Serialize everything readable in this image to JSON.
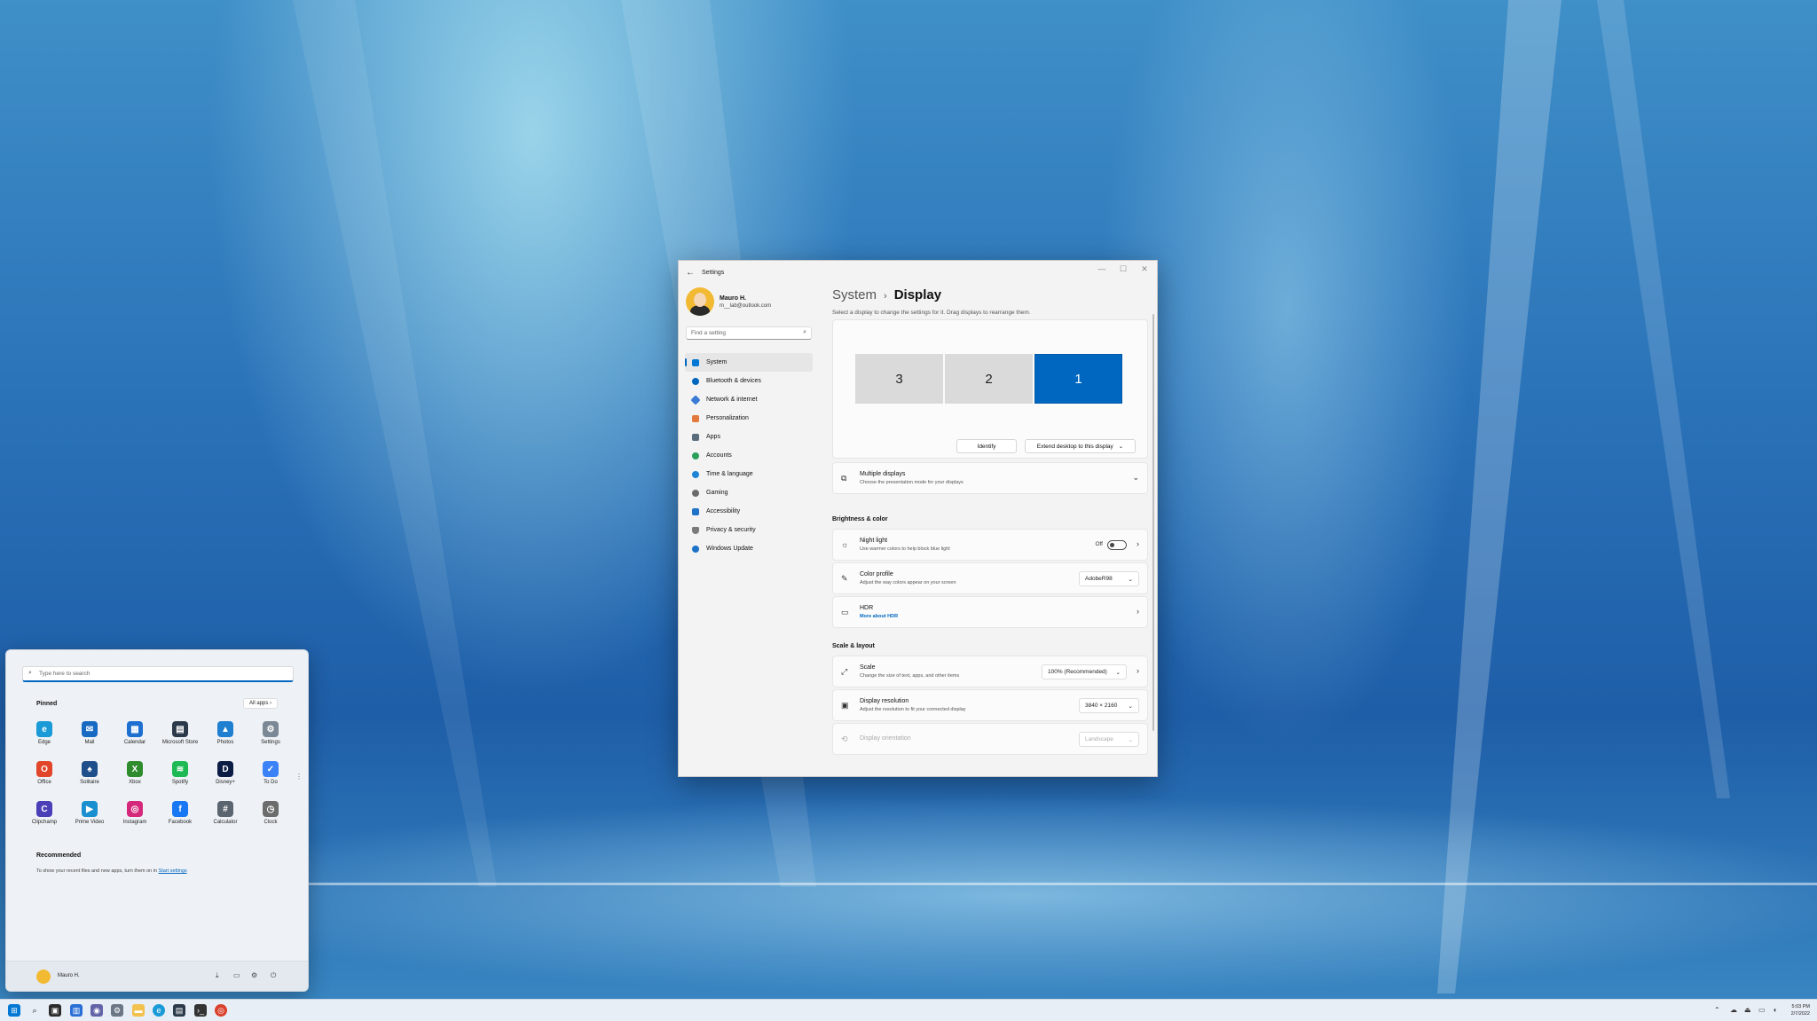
{
  "settings": {
    "window_title": "Settings",
    "user": {
      "name": "Mauro H.",
      "email": "m__lab@outlook.com"
    },
    "search_placeholder": "Find a setting",
    "nav": [
      {
        "label": "System",
        "icon": "monitor-icon",
        "color": "#0078d4"
      },
      {
        "label": "Bluetooth & devices",
        "icon": "bluetooth-icon",
        "color": "#0067c0"
      },
      {
        "label": "Network & internet",
        "icon": "wifi-icon",
        "color": "#3a7bd5"
      },
      {
        "label": "Personalization",
        "icon": "brush-icon",
        "color": "#e3793c"
      },
      {
        "label": "Apps",
        "icon": "apps-icon",
        "color": "#5a6b7b"
      },
      {
        "label": "Accounts",
        "icon": "person-icon",
        "color": "#2aa05a"
      },
      {
        "label": "Time & language",
        "icon": "globe-clock-icon",
        "color": "#1f83d6"
      },
      {
        "label": "Gaming",
        "icon": "gamepad-icon",
        "color": "#6b6b6b"
      },
      {
        "label": "Accessibility",
        "icon": "accessibility-icon",
        "color": "#1e73c8"
      },
      {
        "label": "Privacy & security",
        "icon": "shield-icon",
        "color": "#7a7a7a"
      },
      {
        "label": "Windows Update",
        "icon": "update-icon",
        "color": "#1e73c8"
      }
    ],
    "breadcrumb": {
      "parent": "System",
      "separator": "›",
      "current": "Display"
    },
    "hint": "Select a display to change the settings for it. Drag displays to rearrange them.",
    "monitors": [
      "3",
      "2",
      "1"
    ],
    "active_monitor": "1",
    "identify_label": "Identify",
    "extend_label": "Extend desktop to this display",
    "multiple_displays": {
      "title": "Multiple displays",
      "desc": "Choose the presentation mode for your displays"
    },
    "section_brightness": "Brightness & color",
    "night_light": {
      "title": "Night light",
      "desc": "Use warmer colors to help block blue light",
      "state": "Off"
    },
    "color_profile": {
      "title": "Color profile",
      "desc": "Adjust the way colors appear on your screen",
      "value": "AdobeR98"
    },
    "hdr": {
      "title": "HDR",
      "link": "More about HDR"
    },
    "section_scale": "Scale & layout",
    "scale": {
      "title": "Scale",
      "desc": "Change the size of text, apps, and other items",
      "value": "100% (Recommended)"
    },
    "resolution": {
      "title": "Display resolution",
      "desc": "Adjust the resolution to fit your connected display",
      "value": "3840 × 2160"
    },
    "orientation": {
      "title": "Display orientation",
      "value": "Landscape"
    }
  },
  "start": {
    "search_placeholder": "Type here to search",
    "pinned_label": "Pinned",
    "all_apps_label": "All apps ›",
    "apps": [
      {
        "label": "Edge",
        "icon": "edge-icon",
        "color": "#1a9ad6",
        "glyph": "e"
      },
      {
        "label": "Mail",
        "icon": "mail-icon",
        "color": "#1769c2",
        "glyph": "✉"
      },
      {
        "label": "Calendar",
        "icon": "calendar-icon",
        "color": "#1d6fd0",
        "glyph": "▦"
      },
      {
        "label": "Microsoft Store",
        "icon": "store-icon",
        "color": "#2b3a4a",
        "glyph": "▤"
      },
      {
        "label": "Photos",
        "icon": "photos-icon",
        "color": "#1f7fd1",
        "glyph": "▲"
      },
      {
        "label": "Settings",
        "icon": "gear-icon",
        "color": "#7b8895",
        "glyph": "⚙"
      },
      {
        "label": "Office",
        "icon": "office-icon",
        "color": "#e2462a",
        "glyph": "O"
      },
      {
        "label": "Solitaire",
        "icon": "solitaire-icon",
        "color": "#1e4f8a",
        "glyph": "♠"
      },
      {
        "label": "Xbox",
        "icon": "xbox-icon",
        "color": "#2e8b2e",
        "glyph": "X"
      },
      {
        "label": "Spotify",
        "icon": "spotify-icon",
        "color": "#1db954",
        "glyph": "≋"
      },
      {
        "label": "Disney+",
        "icon": "disney-icon",
        "color": "#0b1c45",
        "glyph": "D"
      },
      {
        "label": "To Do",
        "icon": "todo-icon",
        "color": "#3b82f6",
        "glyph": "✓"
      },
      {
        "label": "Clipchamp",
        "icon": "clipchamp-icon",
        "color": "#4b3fb8",
        "glyph": "C"
      },
      {
        "label": "Prime Video",
        "icon": "prime-video-icon",
        "color": "#1a8fd0",
        "glyph": "▶"
      },
      {
        "label": "Instagram",
        "icon": "instagram-icon",
        "color": "#d6287a",
        "glyph": "◎"
      },
      {
        "label": "Facebook",
        "icon": "facebook-icon",
        "color": "#1877f2",
        "glyph": "f"
      },
      {
        "label": "Calculator",
        "icon": "calculator-icon",
        "color": "#5b6570",
        "glyph": "#"
      },
      {
        "label": "Clock",
        "icon": "clock-icon",
        "color": "#6c6c6c",
        "glyph": "◷"
      }
    ],
    "recommended_label": "Recommended",
    "recommended_msg": "To show your recent files and new apps, turn them on in",
    "recommended_link": "Start settings",
    "user_name": "Mauro H."
  },
  "taskbar": {
    "time": "5:03 PM",
    "date": "2/7/2022"
  }
}
